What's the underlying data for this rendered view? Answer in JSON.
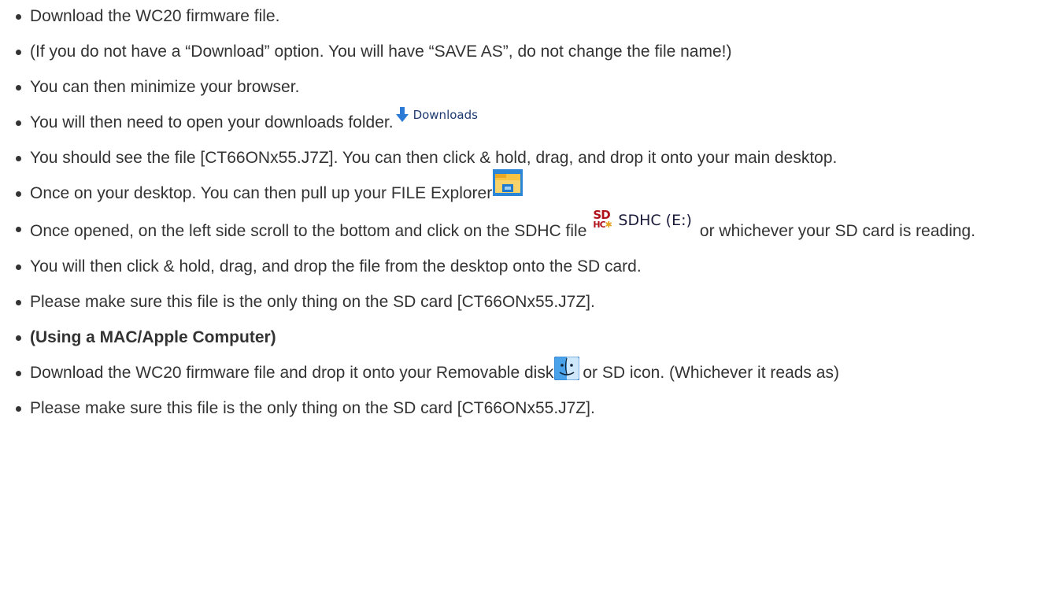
{
  "steps": [
    {
      "text": "Download the WC20 firmware file."
    },
    {
      "text": "(If you do not have a “Download” option. You will have “SAVE AS”, do not change the file name!)"
    },
    {
      "text": "You can then minimize your browser."
    },
    {
      "text": "You will then need to open your downloads folder.",
      "icon_label": "Downloads",
      "icon": "download-arrow-icon"
    },
    {
      "text": "You should see the file [CT66ONx55.J7Z]. You can then click & hold, drag, and drop it onto your main desktop."
    },
    {
      "text": "Once on your desktop. You can then pull up your FILE Explorer",
      "icon": "file-explorer-icon"
    },
    {
      "text_before": "Once opened, on the left side scroll to the bottom and click on the SDHC file",
      "icon_label": "SDHC (E:)",
      "icon": "sd-card-icon",
      "text_after": "or whichever your SD card is reading."
    },
    {
      "text": "You will then click & hold, drag, and drop the file from the desktop onto the SD card."
    },
    {
      "text": "Please make sure this file is the only thing on the SD card [CT66ONx55.J7Z]."
    },
    {
      "text": "(Using a MAC/Apple Computer)"
    },
    {
      "text_before": "Download the WC20 firmware file and drop it onto your Removable disk",
      "icon": "finder-icon",
      "text_after": "or SD icon. (Whichever it reads as)"
    },
    {
      "text": "Please make sure this file is the only thing on the SD card [CT66ONx55.J7Z]."
    }
  ],
  "sd_logo": {
    "top": "SD",
    "bottom": "HC"
  },
  "colors": {
    "text": "#333333",
    "downloads_arrow": "#2a7ad6",
    "sd_red": "#b0121b",
    "explorer_blue": "#1f79cf",
    "explorer_folder": "#f6c343"
  }
}
